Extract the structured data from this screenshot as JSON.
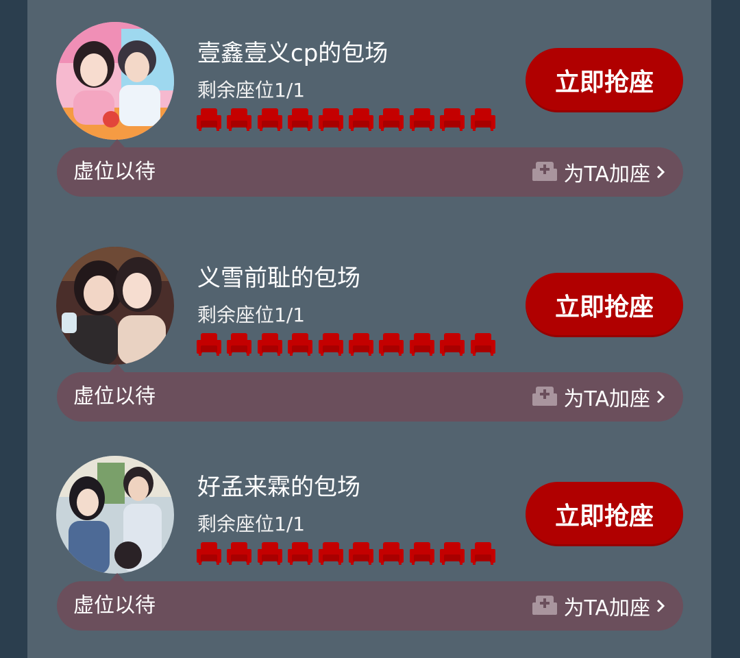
{
  "colors": {
    "background": "#2b3e4e",
    "panel": "#53636f",
    "accent_red": "#b00000",
    "pill": "#6b4f5c"
  },
  "cards": [
    {
      "title": "壹鑫壹义cp的包场",
      "seats_remaining": "剩余座位1/1",
      "seat_icon_count": 10,
      "action_label": "立即抢座",
      "pill_label": "虚位以待",
      "add_seat_label": "为TA加座",
      "avatar": "couple-photo"
    },
    {
      "title": "义雪前耻的包场",
      "seats_remaining": "剩余座位1/1",
      "seat_icon_count": 10,
      "action_label": "立即抢座",
      "pill_label": "虚位以待",
      "add_seat_label": "为TA加座",
      "avatar": "two-women-photo"
    },
    {
      "title": "好孟来霖的包场",
      "seats_remaining": "剩余座位1/1",
      "seat_icon_count": 10,
      "action_label": "立即抢座",
      "pill_label": "虚位以待",
      "add_seat_label": "为TA加座",
      "avatar": "group-photo"
    }
  ]
}
